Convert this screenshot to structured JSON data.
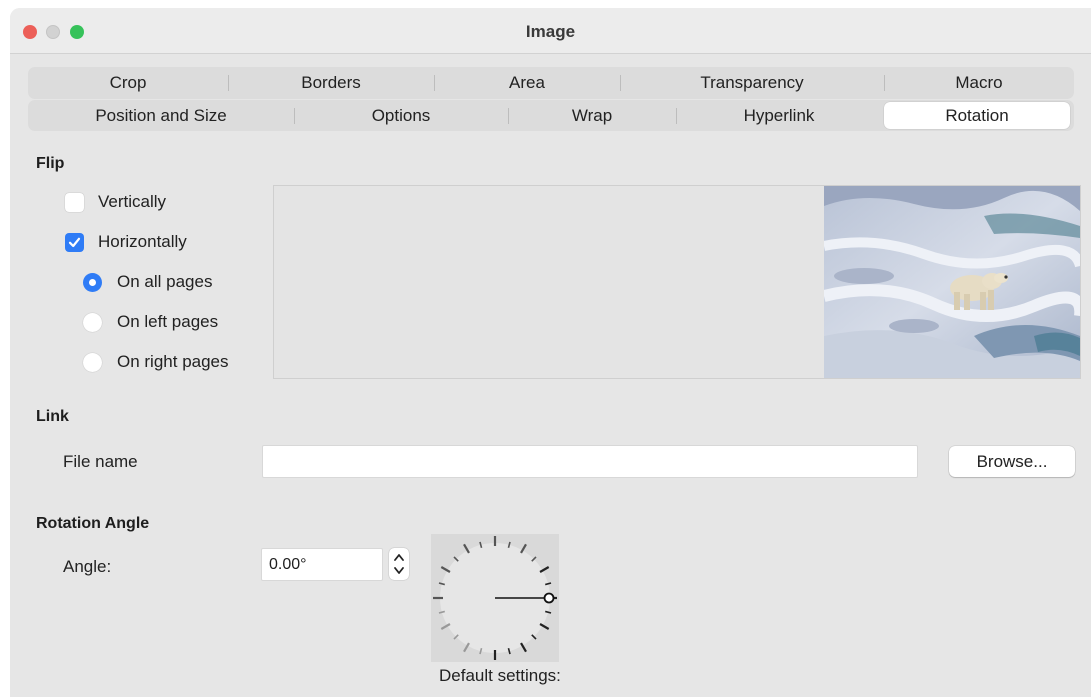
{
  "window": {
    "title": "Image"
  },
  "tabs_row1": [
    "Crop",
    "Borders",
    "Area",
    "Transparency",
    "Macro"
  ],
  "tabs_row2": [
    "Position and Size",
    "Options",
    "Wrap",
    "Hyperlink",
    "Rotation"
  ],
  "active_tab": "Rotation",
  "flip": {
    "heading": "Flip",
    "vertically": {
      "label": "Vertically",
      "checked": false
    },
    "horizontally": {
      "label": "Horizontally",
      "checked": true
    },
    "pages": [
      {
        "label": "On all pages",
        "selected": true
      },
      {
        "label": "On left pages",
        "selected": false
      },
      {
        "label": "On right pages",
        "selected": false
      }
    ]
  },
  "preview": {
    "image": "polar-bear-on-ice"
  },
  "link": {
    "heading": "Link",
    "file_name_label": "File name",
    "file_name_value": "",
    "browse_label": "Browse..."
  },
  "rotation": {
    "heading": "Rotation Angle",
    "angle_label": "Angle:",
    "angle_value": "0.00°",
    "default_settings_label": "Default settings:"
  },
  "colors": {
    "accent": "#2f7cf6",
    "close": "#ec5f58",
    "zoom": "#36c25a"
  }
}
